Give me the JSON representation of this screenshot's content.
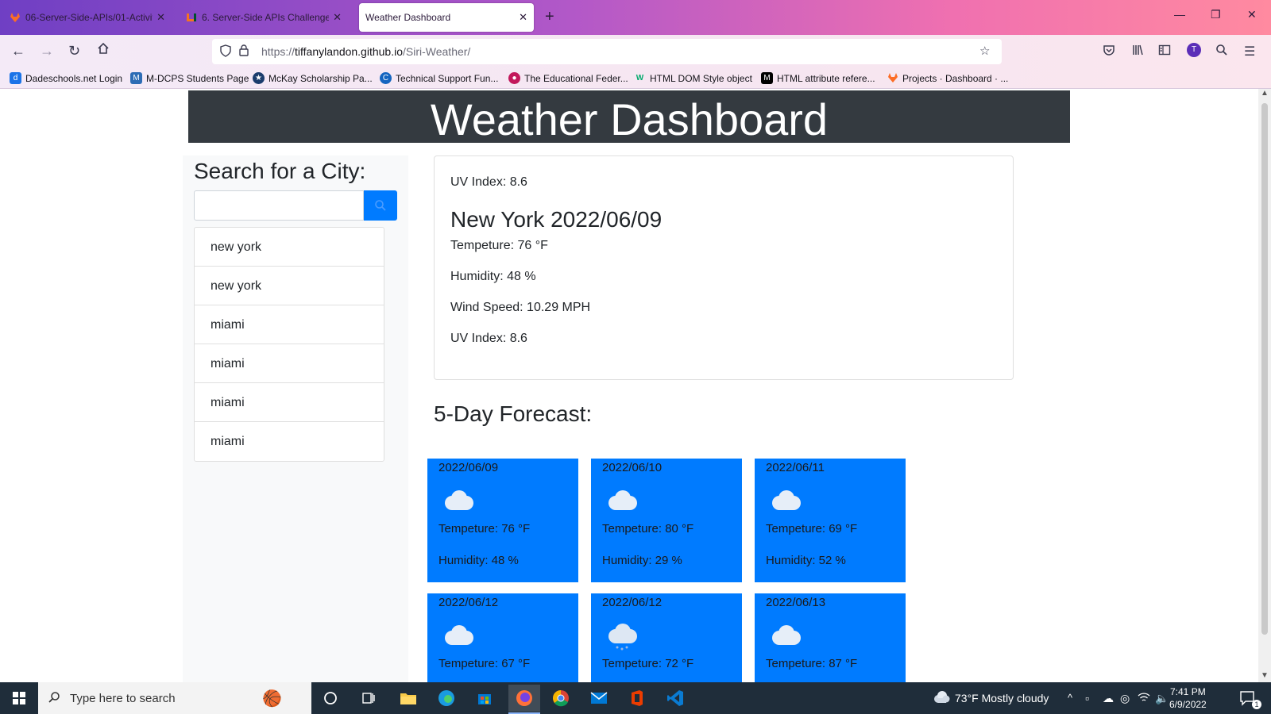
{
  "browser": {
    "tabs": [
      {
        "title": "06-Server-Side-APIs/01-Activiti",
        "active": false
      },
      {
        "title": "6. Server-Side APIs Challenge: W",
        "active": false
      },
      {
        "title": "Weather Dashboard",
        "active": true
      }
    ],
    "url_prefix": "https://",
    "url_host": "tiffanylandon.github.io",
    "url_path": "/Siri-Weather/",
    "profile_initial": "T",
    "bookmarks": [
      "Dadeschools.net Login",
      "M-DCPS Students Page",
      "McKay Scholarship Pa...",
      "Technical Support Fun...",
      "The Educational Feder...",
      "HTML DOM Style object",
      "HTML attribute refere...",
      "Projects · Dashboard · ..."
    ]
  },
  "page": {
    "title": "Weather Dashboard",
    "sidebar": {
      "title": "Search for a City:",
      "search_value": "",
      "history": [
        "new york",
        "new york",
        "miami",
        "miami",
        "miami",
        "miami"
      ]
    },
    "current": {
      "uv_top": "UV Index: 8.6",
      "city_date": "New York 2022/06/09",
      "temp": "Tempeture: 76 °F",
      "humidity": "Humidity: 48 %",
      "wind": "Wind Speed: 10.29 MPH",
      "uv": "UV Index: 8.6"
    },
    "forecast_title": "5-Day Forecast:",
    "forecast": [
      {
        "date": "2022/06/09",
        "icon": "cloud-icon",
        "temp": "Tempeture: 76 °F",
        "humidity": "Humidity: 48 %"
      },
      {
        "date": "2022/06/10",
        "icon": "cloud-icon",
        "temp": "Tempeture: 80 °F",
        "humidity": "Humidity: 29 %"
      },
      {
        "date": "2022/06/11",
        "icon": "cloud-icon",
        "temp": "Tempeture: 69 °F",
        "humidity": "Humidity: 52 %"
      },
      {
        "date": "2022/06/12",
        "icon": "cloud-icon",
        "temp": "Tempeture: 67 °F",
        "humidity": ""
      },
      {
        "date": "2022/06/12",
        "icon": "rain-cloud-icon",
        "temp": "Tempeture: 72 °F",
        "humidity": ""
      },
      {
        "date": "2022/06/13",
        "icon": "cloud-icon",
        "temp": "Tempeture: 87 °F",
        "humidity": ""
      }
    ]
  },
  "taskbar": {
    "search_placeholder": "Type here to search",
    "weather": "73°F  Mostly cloudy",
    "time": "7:41 PM",
    "date": "6/9/2022",
    "notifications": "1"
  },
  "colors": {
    "accent": "#007bff",
    "header_bg": "#343a40",
    "sidebar_bg": "#f8f9fa"
  }
}
